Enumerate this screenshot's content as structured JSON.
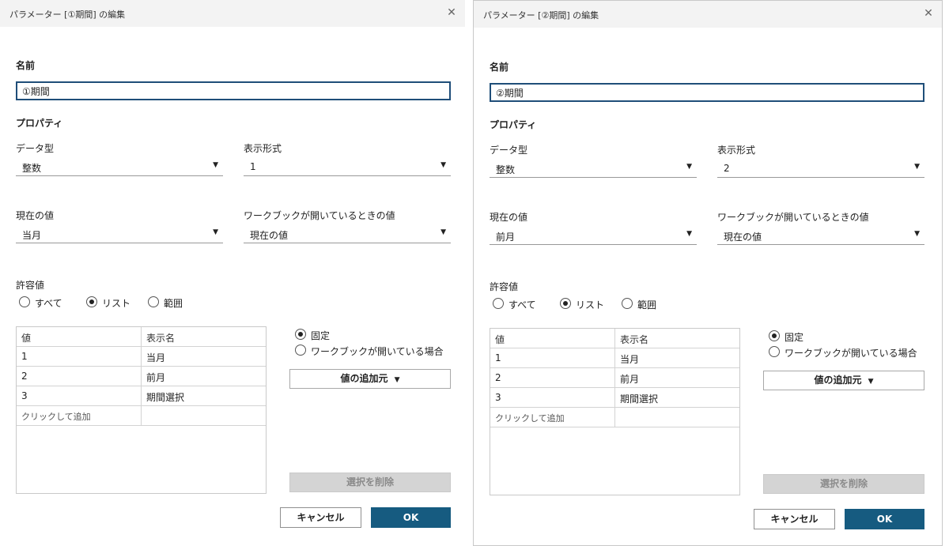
{
  "dialogs": [
    {
      "title": "パラメーター [①期間] の編集",
      "close_symbol": "✕",
      "name_label": "名前",
      "name_value": "①期間",
      "properties_label": "プロパティ",
      "data_type_label": "データ型",
      "data_type_value": "整数",
      "display_format_label": "表示形式",
      "display_format_value": "1",
      "current_value_label": "現在の値",
      "current_value_value": "当月",
      "workbook_open_label": "ワークブックが開いているときの値",
      "workbook_open_value": "現在の値",
      "allowed_values_label": "許容値",
      "allowed_options": [
        "すべて",
        "リスト",
        "範囲"
      ],
      "allowed_selected": "リスト",
      "table": {
        "headers": [
          "値",
          "表示名"
        ],
        "rows": [
          [
            "1",
            "当月"
          ],
          [
            "2",
            "前月"
          ],
          [
            "3",
            "期間選択"
          ]
        ],
        "add_row_text": "クリックして追加"
      },
      "source_options": [
        "固定",
        "ワークブックが開いている場合"
      ],
      "source_selected": "固定",
      "add_values_from_label": "値の追加元",
      "delete_selection_label": "選択を削除",
      "cancel_label": "キャンセル",
      "ok_label": "OK"
    },
    {
      "title": "パラメーター [②期間] の編集",
      "close_symbol": "✕",
      "name_label": "名前",
      "name_value": "②期間",
      "properties_label": "プロパティ",
      "data_type_label": "データ型",
      "data_type_value": "整数",
      "display_format_label": "表示形式",
      "display_format_value": "2",
      "current_value_label": "現在の値",
      "current_value_value": "前月",
      "workbook_open_label": "ワークブックが開いているときの値",
      "workbook_open_value": "現在の値",
      "allowed_values_label": "許容値",
      "allowed_options": [
        "すべて",
        "リスト",
        "範囲"
      ],
      "allowed_selected": "リスト",
      "table": {
        "headers": [
          "値",
          "表示名"
        ],
        "rows": [
          [
            "1",
            "当月"
          ],
          [
            "2",
            "前月"
          ],
          [
            "3",
            "期間選択"
          ]
        ],
        "add_row_text": "クリックして追加"
      },
      "source_options": [
        "固定",
        "ワークブックが開いている場合"
      ],
      "source_selected": "固定",
      "add_values_from_label": "値の追加元",
      "delete_selection_label": "選択を削除",
      "cancel_label": "キャンセル",
      "ok_label": "OK"
    }
  ],
  "icons": {
    "dropdown_arrow": "▼",
    "close": "close-icon",
    "radio": "radio-button"
  },
  "colors": {
    "accent": "#165b80",
    "input_border": "#1f4e79",
    "titlebar_bg": "#f3f3f3",
    "disabled_button_bg": "#d4d4d4"
  }
}
